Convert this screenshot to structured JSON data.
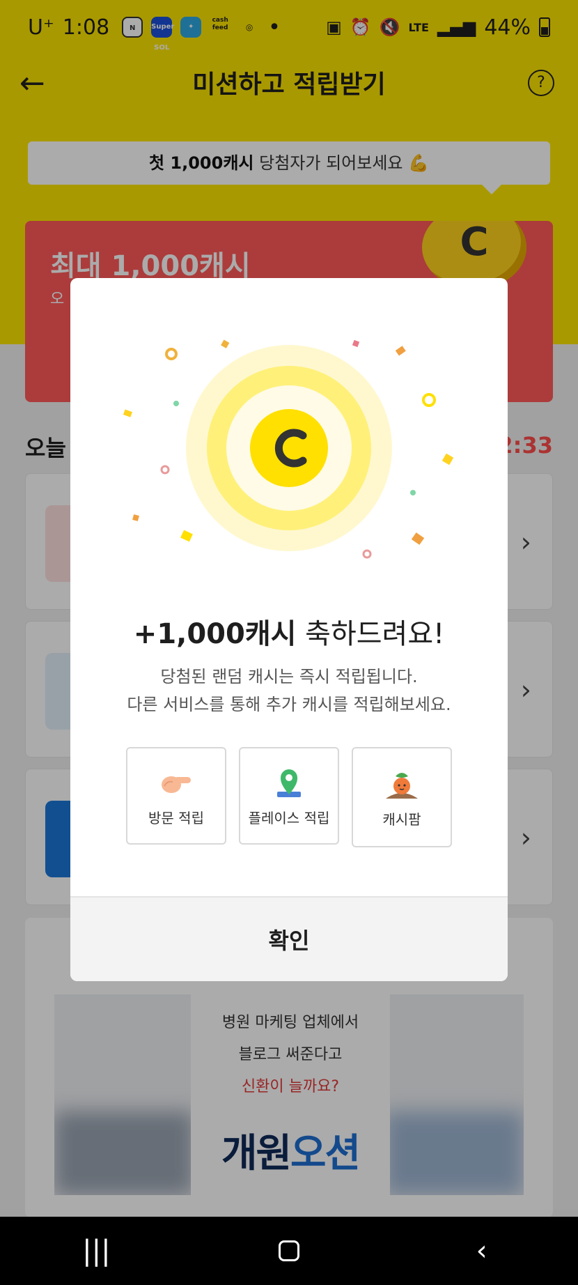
{
  "status_bar": {
    "carrier": "U⁺",
    "time": "1:08",
    "app_icons": [
      "naver-icon",
      "supersol-icon",
      "app-icon",
      "cash-feed-icon",
      "ok-icon"
    ],
    "supersol_label": "Super SOL",
    "cashfeed_label": "cash feed",
    "network": "LTE",
    "battery_percent": "44%"
  },
  "header": {
    "title": "미션하고 적립받기"
  },
  "banner": {
    "prefix": "첫 1,000캐시",
    "suffix": " 당첨자가 되어보세요 💪"
  },
  "promo": {
    "title": "최대 1,000캐시",
    "subtitle": "오"
  },
  "today": {
    "title": "오늘",
    "timer": "2:33"
  },
  "ad": {
    "line1": "병원 마케팅 업체에서",
    "line2": "블로그 써준다고",
    "line3": "신환이 늘까요?",
    "brand_part1": "개원",
    "brand_part2": "오션"
  },
  "dialog": {
    "amount": "+1,000캐시",
    "heading_rest": " 축하드려요!",
    "desc_line1": "당첨된 랜덤 캐시는 즉시 적립됩니다.",
    "desc_line2": "다른 서비스를 통해 추가 캐시를 적립해보세요.",
    "tiles": [
      {
        "label": "방문 적립",
        "icon": "pointing-hand-icon"
      },
      {
        "label": "플레이스 적립",
        "icon": "map-pin-icon"
      },
      {
        "label": "캐시팜",
        "icon": "carrot-icon"
      }
    ],
    "confirm_label": "확인",
    "coin_letter": "C"
  },
  "colors": {
    "brand_yellow": "#fde400",
    "promo_red": "#ff5a58",
    "timer_red": "#ff4d4d",
    "coin_yellow": "#ffe000"
  }
}
